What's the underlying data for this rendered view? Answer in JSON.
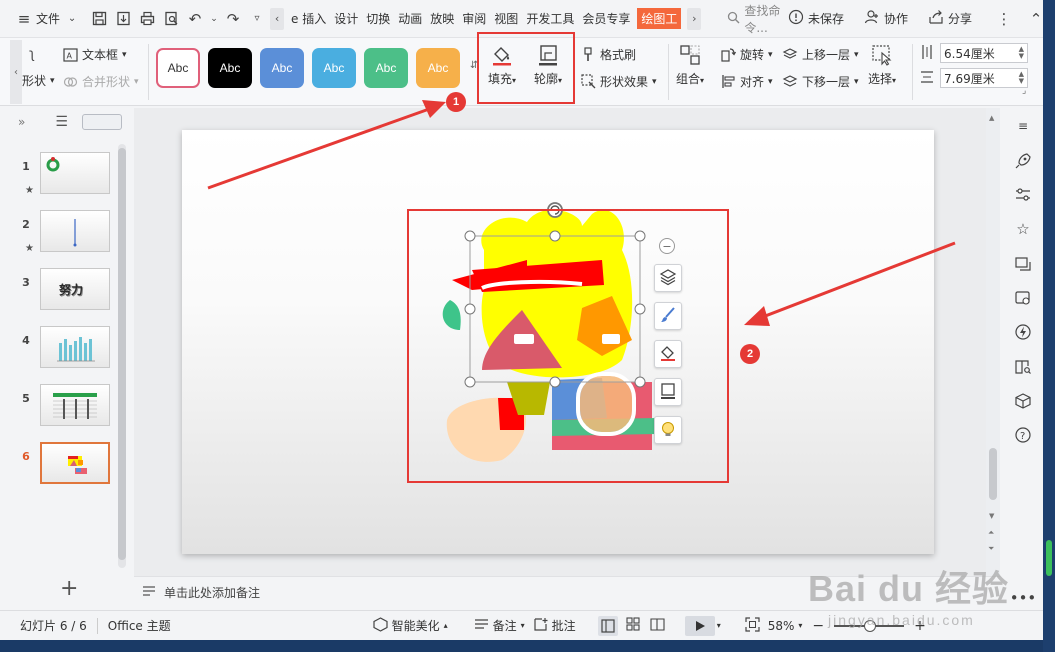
{
  "titlebar": {
    "file_label": "文件",
    "tabs": [
      {
        "label": "e 插入",
        "active": false
      },
      {
        "label": "设计",
        "active": false
      },
      {
        "label": "切换",
        "active": false
      },
      {
        "label": "动画",
        "active": false
      },
      {
        "label": "放映",
        "active": false
      },
      {
        "label": "审阅",
        "active": false
      },
      {
        "label": "视图",
        "active": false
      },
      {
        "label": "开发工具",
        "active": false
      },
      {
        "label": "会员专享",
        "active": false
      },
      {
        "label": "绘图工",
        "active": true
      }
    ],
    "search_placeholder": "查找命令...",
    "unsaved_label": "未保存",
    "collab_label": "协作",
    "share_label": "分享"
  },
  "ribbon": {
    "shape_label": "形状",
    "textbox_label": "文本框",
    "merge_shape_label": "合并形状",
    "style_swatches": [
      {
        "label": "Abc",
        "bg": "#ffffff",
        "fg": "#333333",
        "border": "#e0607a"
      },
      {
        "label": "Abc",
        "bg": "#000000",
        "fg": "#ffffff",
        "border": "#000000"
      },
      {
        "label": "Abc",
        "bg": "#5b8fd8",
        "fg": "#ffffff",
        "border": "#5b8fd8"
      },
      {
        "label": "Abc",
        "bg": "#4aaee0",
        "fg": "#ffffff",
        "border": "#4aaee0"
      },
      {
        "label": "Abc",
        "bg": "#4cbf88",
        "fg": "#ffffff",
        "border": "#4cbf88"
      },
      {
        "label": "Abc",
        "bg": "#f6b04a",
        "fg": "#ffffff",
        "border": "#f6b04a"
      }
    ],
    "fill_label": "填充",
    "outline_label": "轮廓",
    "format_painter_label": "格式刷",
    "shape_effect_label": "形状效果",
    "group_label": "组合",
    "rotate_label": "旋转",
    "align_label": "对齐",
    "bring_forward_label": "上移一层",
    "send_backward_label": "下移一层",
    "select_label": "选择",
    "height_value": "6.54厘米",
    "width_value": "7.69厘米"
  },
  "slides": [
    {
      "num": "1",
      "starred": true
    },
    {
      "num": "2",
      "starred": true
    },
    {
      "num": "3",
      "starred": false,
      "text": "努力"
    },
    {
      "num": "4",
      "starred": false
    },
    {
      "num": "5",
      "starred": false
    },
    {
      "num": "6",
      "starred": false,
      "active": true
    }
  ],
  "notes_placeholder": "单击此处添加备注",
  "annotations": {
    "badge1": "1",
    "badge2": "2"
  },
  "statusbar": {
    "slide_counter": "幻灯片 6 / 6",
    "theme": "Office 主题",
    "smart_beautify": "智能美化",
    "notes": "备注",
    "comments": "批注",
    "zoom": "58%"
  },
  "watermark": {
    "main": "Bai du 经验",
    "sub": "jingyan.baidu.com"
  },
  "colors": {
    "accent": "#f4683c",
    "annotation_red": "#e53935"
  }
}
